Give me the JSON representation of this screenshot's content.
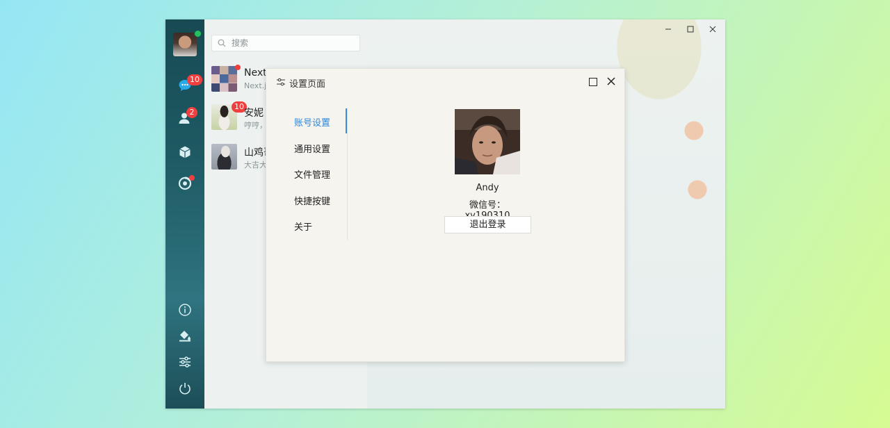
{
  "search": {
    "placeholder": "搜索"
  },
  "sidebar": {
    "chat_badge": "10",
    "contacts_badge": "2"
  },
  "chats": [
    {
      "name": "Next.",
      "preview": "Next.j"
    },
    {
      "name": "安妮",
      "preview": "哼哼，",
      "badge": "10"
    },
    {
      "name": "山鸡哥",
      "preview": "大吉大"
    }
  ],
  "settings": {
    "title": "设置页面",
    "menu": [
      "账号设置",
      "通用设置",
      "文件管理",
      "快捷按键",
      "关于"
    ],
    "active_index": 0,
    "profile": {
      "name": "Andy",
      "wechat_id": "微信号：xy190310",
      "logout_label": "退出登录"
    }
  },
  "colors": {
    "accent": "#2c86d9",
    "badge": "#ef3f3f",
    "online": "#24c15c"
  }
}
